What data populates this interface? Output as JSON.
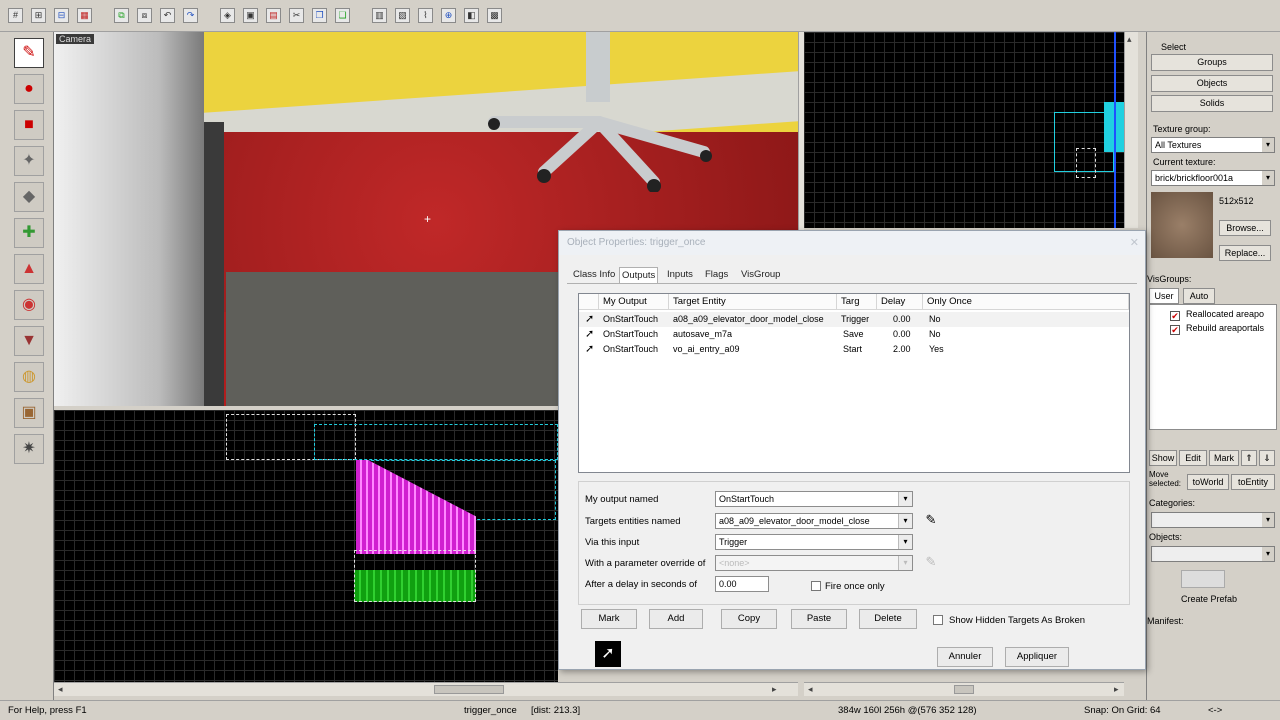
{
  "toolbar": {
    "icons": [
      "grid-icon",
      "grid-smaller-icon",
      "grid-larger-icon",
      "grid-toggle-icon",
      "group-icon",
      "ungroup-icon",
      "undo-icon",
      "redo-icon",
      "compile-icon",
      "camera-icon",
      "texture-lock-icon",
      "cut-icon",
      "copy-icon",
      "paste-icon",
      "carve-icon",
      "hollow-icon",
      "clip-icon",
      "vertex-icon",
      "entity-icon",
      "map-icon"
    ]
  },
  "palette": {
    "tools": [
      "pointer-tool",
      "magnify-tool",
      "camera-tool",
      "entity-tool",
      "block-tool",
      "texture-tool",
      "apply-texture-tool",
      "decal-tool",
      "overlay-tool",
      "clip-tool",
      "vertex-tool",
      "path-tool"
    ]
  },
  "view3d": {
    "label": "Camera"
  },
  "right_panel": {
    "select_label": "Select",
    "buttons": [
      "Groups",
      "Objects",
      "Solids"
    ],
    "texture_group_label": "Texture group:",
    "texture_group_value": "All Textures",
    "current_texture_label": "Current texture:",
    "current_texture_value": "brick/brickfloor001a",
    "texture_size": "512x512",
    "browse_label": "Browse...",
    "replace_label": "Replace...",
    "visgroups_label": "VisGroups:",
    "visgroup_tabs": [
      "User",
      "Auto"
    ],
    "visgroup_items": [
      "Reallocated areapo",
      "Rebuild areaportals"
    ],
    "show_label": "Show",
    "edit_label": "Edit",
    "mark_label": "Mark",
    "move_selected_label": "Move selected:",
    "to_world_label": "toWorld",
    "to_entity_label": "toEntity",
    "categories_label": "Categories:",
    "objects_label": "Objects:",
    "create_prefab_label": "Create Prefab",
    "manifest_label": "Manifest:"
  },
  "dialog": {
    "title": "Object Properties: trigger_once",
    "tabs": [
      "Class Info",
      "Outputs",
      "Inputs",
      "Flags",
      "VisGroup"
    ],
    "active_tab": "Outputs",
    "columns": [
      "My Output",
      "Target Entity",
      "Targ",
      "Delay",
      "Only Once"
    ],
    "rows": [
      {
        "output": "OnStartTouch",
        "target": "a08_a09_elevator_door_model_close",
        "input": "Trigger",
        "delay": "0.00",
        "once": "No"
      },
      {
        "output": "OnStartTouch",
        "target": "autosave_m7a",
        "input": "Save",
        "delay": "0.00",
        "once": "No"
      },
      {
        "output": "OnStartTouch",
        "target": "vo_ai_entry_a09",
        "input": "Start",
        "delay": "2.00",
        "once": "Yes"
      }
    ],
    "form": {
      "output_label": "My output named",
      "output_value": "OnStartTouch",
      "target_label": "Targets entities named",
      "target_value": "a08_a09_elevator_door_model_close",
      "input_label": "Via this input",
      "input_value": "Trigger",
      "param_label": "With a parameter override of",
      "param_value": "<none>",
      "delay_label": "After a delay in seconds of",
      "delay_value": "0.00",
      "fire_once_label": "Fire once only"
    },
    "buttons": {
      "mark": "Mark",
      "add": "Add",
      "copy": "Copy",
      "paste": "Paste",
      "delete": "Delete",
      "show_hidden": "Show Hidden Targets As Broken",
      "cancel": "Annuler",
      "apply": "Appliquer"
    }
  },
  "statusbar": {
    "help": "For Help, press F1",
    "selection": "trigger_once",
    "dist": "[dist: 213.3]",
    "size": "384w 160l 256h @(576 352 128)",
    "snap": "Snap: On Grid: 64",
    "arrows": "<->"
  },
  "colors": {
    "magenta_brush": "#d020d0",
    "green_brush": "#10a010",
    "grid_bg": "#000000",
    "cyan_selection": "#20d0e0"
  }
}
